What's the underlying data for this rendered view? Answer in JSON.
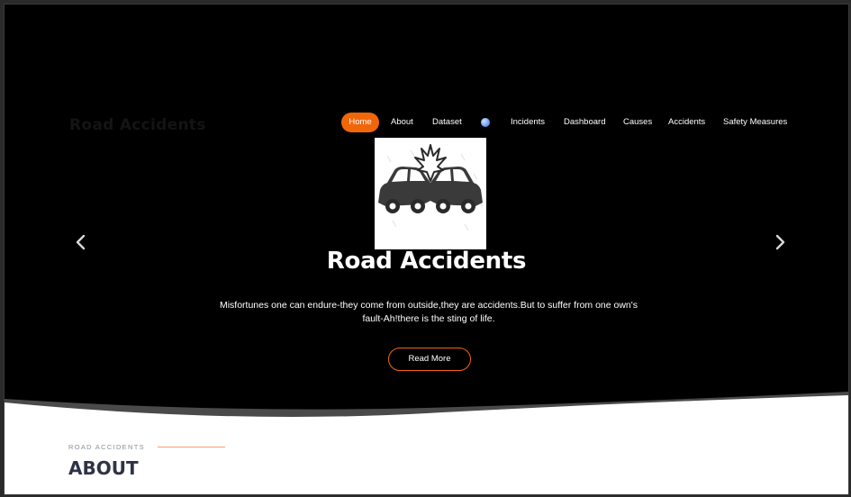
{
  "site": {
    "brand": "Road Accidents"
  },
  "nav": {
    "items": [
      {
        "label": "Home",
        "active": true
      },
      {
        "label": "About"
      },
      {
        "label": "Dataset"
      },
      {
        "label": "Incidents"
      },
      {
        "label": "Dashboard"
      },
      {
        "label": "Causes"
      },
      {
        "label": "Accidents"
      },
      {
        "label": "Safety Measures"
      }
    ],
    "dot_icon": "globe-icon"
  },
  "hero": {
    "image_icon": "car-crash-icon",
    "title": "Road Accidents",
    "text": "Misfortunes one can endure-they come from outside,they are accidents.But to suffer from one own's fault-Ah!there is the sting of life.",
    "button_label": "Read More",
    "prev_icon": "chevron-left-icon",
    "next_icon": "chevron-right-icon"
  },
  "about": {
    "eyebrow": "ROAD ACCIDENTS",
    "title": "ABOUT"
  },
  "colors": {
    "accent": "#f2660a",
    "hero_bg": "#000000",
    "heading": "#2e3344"
  }
}
